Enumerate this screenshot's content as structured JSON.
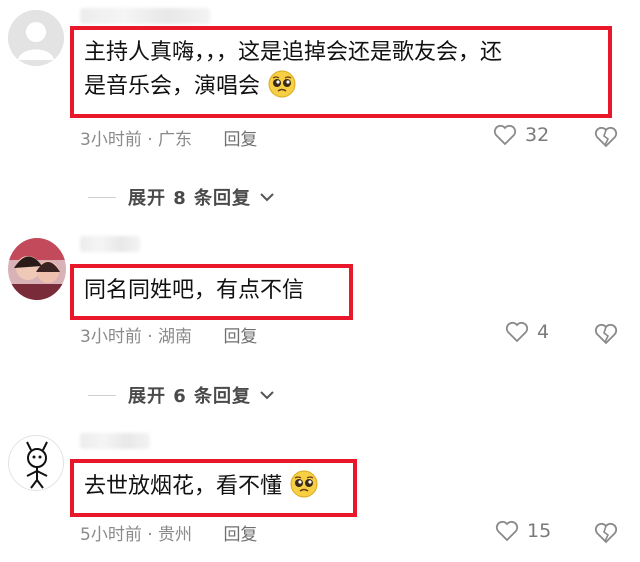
{
  "comments": [
    {
      "text": "主持人真嗨，，，这是追掉会还是歌友会，还是音乐会，演唱会",
      "line1": "主持人真嗨，，，这是追掉会还是歌友会，还",
      "line2": "是音乐会，演唱会",
      "emoji": "pleading-face-icon",
      "meta": "3小时前 · 广东",
      "reply_label": "回复",
      "likes": "32"
    },
    {
      "text": "同名同姓吧，有点不信",
      "meta": "3小时前 · 湖南",
      "reply_label": "回复",
      "likes": "4"
    },
    {
      "text": "去世放烟花，看不懂",
      "emoji": "pleading-face-icon",
      "meta": "5小时前 · 贵州",
      "reply_label": "回复",
      "likes": "15"
    }
  ],
  "expands": [
    {
      "label": "展开 8 条回复"
    },
    {
      "label": "展开 6 条回复"
    }
  ],
  "colors": {
    "highlight_border": "#e8182a",
    "meta_text": "#8a8a8a"
  }
}
